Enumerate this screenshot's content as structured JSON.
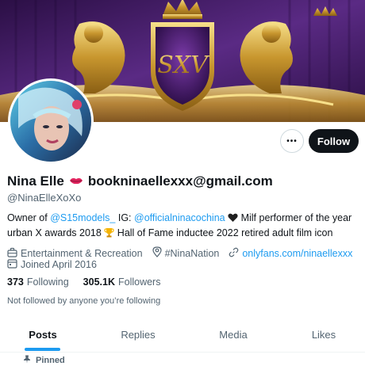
{
  "banner": {
    "monogram": "SXV"
  },
  "header": {
    "more_label": "•••",
    "follow_label": "Follow"
  },
  "profile": {
    "name": "Nina Elle",
    "name_suffix": "bookninaellexxx@gmail.com",
    "handle": "@NinaElleXoXo",
    "bio": {
      "part1": "Owner of ",
      "mention1": "@S15models_",
      "part2": " IG: ",
      "mention2": "@officialninacochina",
      "part3": " Milf performer of the year urban X awards 2018 ",
      "part4": " Hall of Fame inductee 2022 retired adult film icon"
    },
    "category": "Entertainment & Recreation",
    "location": "#NinaNation",
    "link": "onlyfans.com/ninaellexxx",
    "joined": "Joined April 2016",
    "following_count": "373",
    "following_label": "Following",
    "followers_count": "305.1K",
    "followers_label": "Followers",
    "not_followed": "Not followed by anyone you’re following"
  },
  "tabs": [
    {
      "label": "Posts"
    },
    {
      "label": "Replies"
    },
    {
      "label": "Media"
    },
    {
      "label": "Likes"
    }
  ],
  "pinned_label": "Pinned",
  "colors": {
    "accent": "#1d9bf0",
    "text": "#0f1419",
    "muted": "#536471",
    "banner_purple": "#4a1f6e",
    "banner_gold": "#d4a94a"
  }
}
